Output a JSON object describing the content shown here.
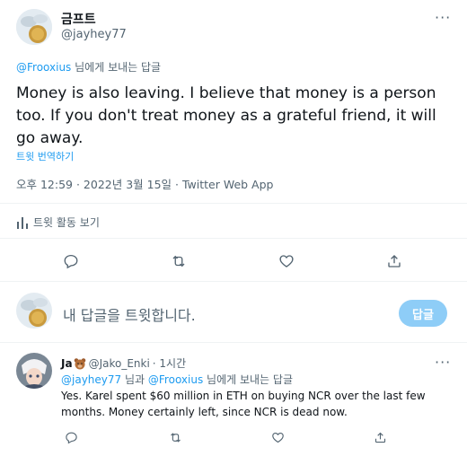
{
  "main_tweet": {
    "display_name": "금프트",
    "handle": "@jayhey77",
    "reply_to_user": "@Frooxius",
    "reply_to_suffix": "님에게 보내는 답글",
    "text": "Money is also leaving. I believe that money is a person too. If you don't treat money as a grateful friend, it will go away.",
    "translate_label": "트윗 번역하기",
    "timestamp": "오후 12:59 · 2022년 3월 15일 · Twitter Web App",
    "activity_label": "트윗 활동 보기",
    "more_label": "···"
  },
  "compose": {
    "placeholder": "내 답글을 트윗합니다.",
    "reply_button": "답글"
  },
  "reply_tweet": {
    "display_name": "Ja",
    "handle": "@Jako_Enki",
    "time": "· 1시간",
    "reply_to_user_1": "@jayhey77",
    "reply_to_mid": "님과",
    "reply_to_user_2": "@Frooxius",
    "reply_to_suffix": "님에게 보내는 답글",
    "text": "Yes. Karel spent $60 million in ETH on buying NCR over the last few months. Money certainly left, since NCR is dead now.",
    "more_label": "···"
  },
  "colors": {
    "accent": "#1d9bf0",
    "muted": "#536471",
    "reply_button_bg": "#8ecdf7",
    "divider": "#eff3f4"
  },
  "icons": [
    "chat-bubble-icon",
    "retweet-icon",
    "heart-icon",
    "share-icon",
    "bar-chart-icon",
    "bear-emoji-icon"
  ]
}
